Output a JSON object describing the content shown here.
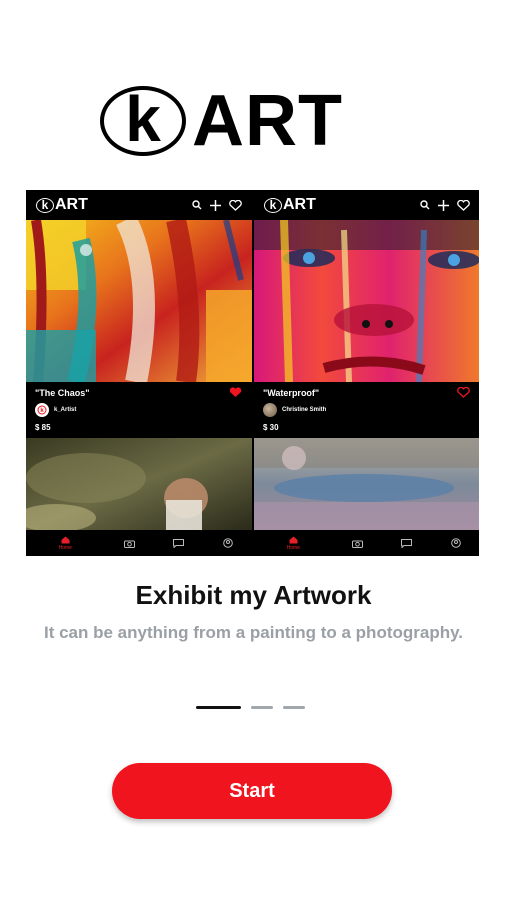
{
  "brand": {
    "logo_letter": "k",
    "logo_text": "ART"
  },
  "preview": {
    "left_card": {
      "title": "\"The Chaos\"",
      "artist": "k_Artist",
      "price": "$ 85",
      "liked": true
    },
    "right_card": {
      "title": "\"Waterproof\"",
      "artist": "Christine Smith",
      "price": "$ 30",
      "liked": false
    },
    "tab_home_label": "Home"
  },
  "onboarding": {
    "headline": "Exhibit my Artwork",
    "subtitle": "It can be anything from a painting to a photography.",
    "page_count": 3,
    "active_page": 1
  },
  "actions": {
    "start_label": "Start"
  },
  "colors": {
    "accent": "#f0141e",
    "subtitle": "#9aa0a6",
    "pager_inactive": "#a0a7ad"
  }
}
